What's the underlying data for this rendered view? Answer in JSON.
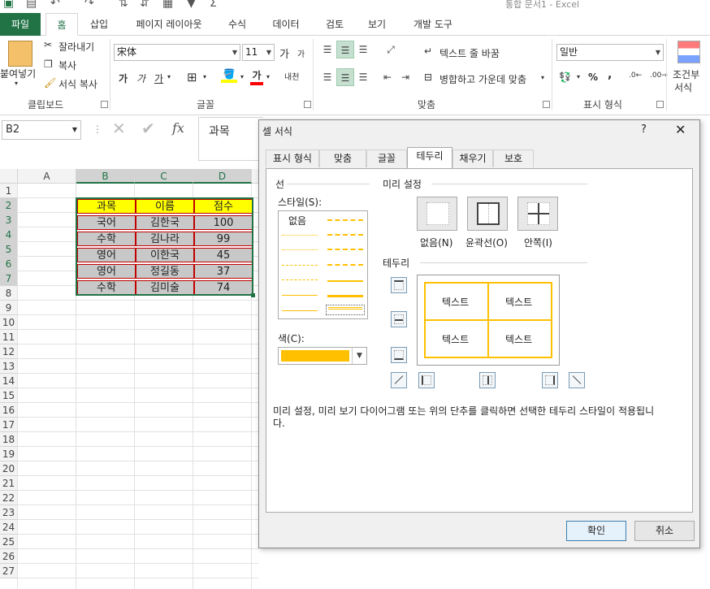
{
  "window": {
    "title": "통합 문서1 - Excel"
  },
  "ribbon_tabs": {
    "file": "파일",
    "home": "홈",
    "insert": "삽입",
    "layout": "페이지 레이아웃",
    "formulas": "수식",
    "data": "데이터",
    "review": "검토",
    "view": "보기",
    "developer": "개발 도구"
  },
  "clipboard": {
    "paste": "붙여넣기",
    "cut": "잘라내기",
    "copy": "복사",
    "format_painter": "서식 복사",
    "label": "클립보드"
  },
  "font": {
    "name": "宋体",
    "size": "11",
    "label": "글꼴",
    "grow": "가",
    "shrink": "가",
    "bold": "가",
    "italic": "가",
    "underline": "가",
    "fontcolor": "가",
    "phonetic": "내천"
  },
  "alignment": {
    "wrap": "텍스트 줄 바꿈",
    "merge": "병합하고 가운데 맞춤",
    "label": "맞춤"
  },
  "number": {
    "format": "일반",
    "label": "표시 형식",
    "percent": "%",
    "comma": ","
  },
  "styles": {
    "conditional": "조건부",
    "conditional2": "서식"
  },
  "formula_bar": {
    "name_box": "B2",
    "content": "과목"
  },
  "sheet": {
    "columns": [
      "A",
      "B",
      "C",
      "D"
    ],
    "rows": [
      "1",
      "2",
      "3",
      "4",
      "5",
      "6",
      "7",
      "8",
      "9",
      "10",
      "11",
      "12",
      "13",
      "14",
      "15",
      "16",
      "17",
      "18",
      "19",
      "20",
      "21",
      "22",
      "23",
      "24",
      "25",
      "26",
      "27"
    ],
    "table": {
      "header": [
        "과목",
        "이름",
        "점수"
      ],
      "rows": [
        [
          "국어",
          "김한국",
          "100"
        ],
        [
          "수학",
          "김나라",
          "99"
        ],
        [
          "영어",
          "이한국",
          "45"
        ],
        [
          "영어",
          "정길동",
          "37"
        ],
        [
          "수학",
          "김미술",
          "74"
        ]
      ]
    }
  },
  "dialog": {
    "title": "셀 서식",
    "help": "?",
    "close": "✕",
    "tabs": [
      "표시 형식",
      "맞춤",
      "글꼴",
      "테두리",
      "채우기",
      "보호"
    ],
    "line_group": "선",
    "style_label": "스타일(S):",
    "style_none": "없음",
    "color_label": "색(C):",
    "color_value": "#ffc000",
    "presets_group": "미리 설정",
    "presets": [
      "없음(N)",
      "윤곽선(O)",
      "안쪽(I)"
    ],
    "border_group": "테두리",
    "preview_text": [
      "텍스트",
      "텍스트",
      "텍스트",
      "텍스트"
    ],
    "hint": "미리 설정, 미리 보기 다이어그램 또는 위의 단추를 클릭하면 선택한 테두리 스타일이 적용됩니다.",
    "ok": "확인",
    "cancel": "취소"
  }
}
